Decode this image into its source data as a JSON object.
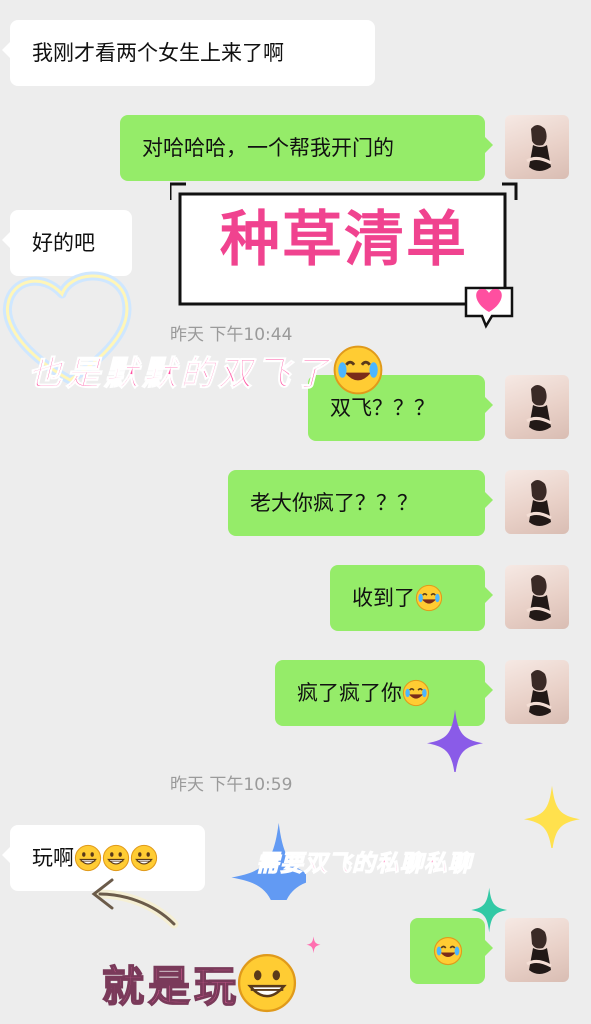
{
  "messages": [
    {
      "side": "in",
      "text": "我刚才看两个女生上来了啊"
    },
    {
      "side": "out",
      "text": "对哈哈哈，一个帮我开门的"
    },
    {
      "side": "in",
      "text": "好的吧"
    },
    {
      "side": "out",
      "text": "双飞？？？"
    },
    {
      "side": "out",
      "text": "老大你疯了？？？"
    },
    {
      "side": "out",
      "text": "收到了"
    },
    {
      "side": "out",
      "text": "疯了疯了你"
    },
    {
      "side": "in",
      "text": "玩啊"
    }
  ],
  "timestamps": [
    "昨天 下午10:44",
    "昨天 下午10:59"
  ],
  "overlay": {
    "title": "种草清单",
    "caption1": "也是默默的双飞了",
    "caption2": "需要双飞的私聊私聊",
    "caption3": "就是玩"
  },
  "icons": {
    "laugh_cry": "face-with-tears-of-joy-emoji",
    "grin": "grinning-face-emoji",
    "heart": "heart-icon",
    "sparkle": "sparkle-icon"
  },
  "colors": {
    "outgoing_bubble": "#95ec69",
    "incoming_bubble": "#ffffff",
    "background": "#ededed",
    "title_pink": "#f0438f"
  }
}
